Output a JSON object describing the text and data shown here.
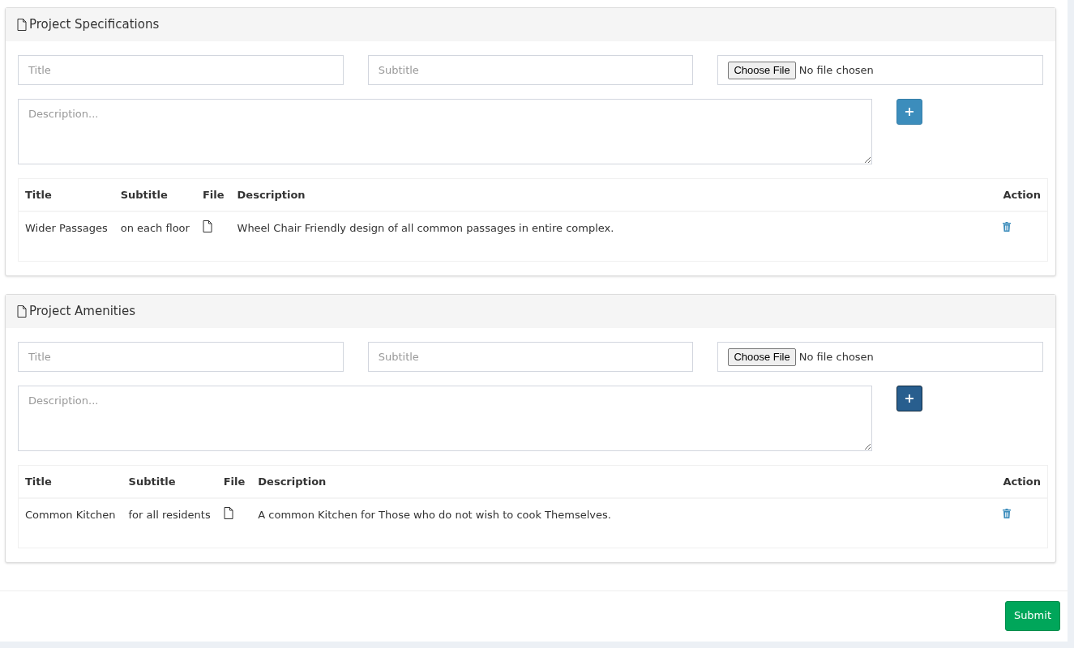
{
  "panels": [
    {
      "title": "Project Specifications",
      "title_placeholder": "Title",
      "subtitle_placeholder": "Subtitle",
      "file_button": "Choose File",
      "file_status": "No file chosen",
      "description_placeholder": "Description...",
      "add_button": {
        "label": "+",
        "focused": false
      },
      "table": {
        "columns": [
          "Title",
          "Subtitle",
          "File",
          "Description",
          "Action"
        ],
        "rows": [
          {
            "title": "Wider Passages",
            "subtitle": "on each floor",
            "description": "Wheel Chair Friendly design of all common passages in entire complex."
          }
        ]
      }
    },
    {
      "title": "Project Amenities",
      "title_placeholder": "Title",
      "subtitle_placeholder": "Subtitle",
      "file_button": "Choose File",
      "file_status": "No file chosen",
      "description_placeholder": "Description...",
      "add_button": {
        "label": "+",
        "focused": true
      },
      "table": {
        "columns": [
          "Title",
          "Subtitle",
          "File",
          "Description",
          "Action"
        ],
        "rows": [
          {
            "title": "Common Kitchen",
            "subtitle": "for all residents",
            "description": "A common Kitchen for Those who do not wish to cook Themselves."
          }
        ]
      }
    }
  ],
  "submit": "Submit"
}
